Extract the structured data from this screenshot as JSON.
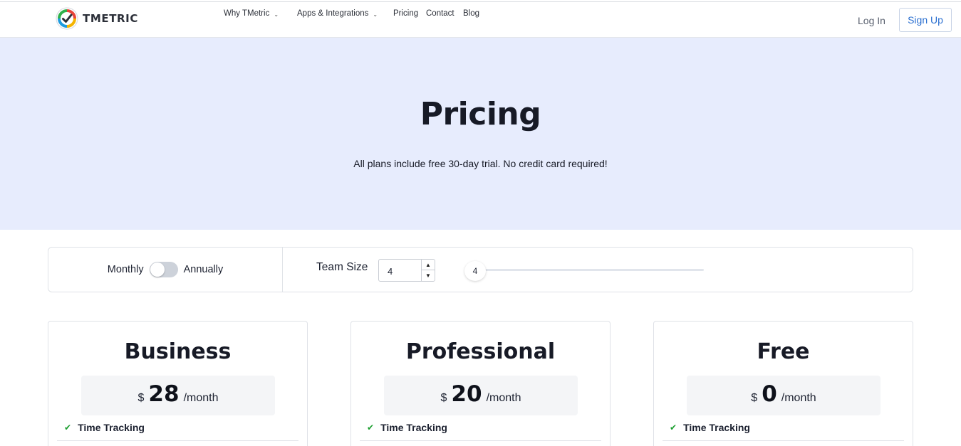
{
  "header": {
    "brand": "TMETRIC",
    "nav": [
      {
        "label": "Why TMetric",
        "dropdown": true
      },
      {
        "label": "Apps & Integrations",
        "dropdown": true
      },
      {
        "label": "Pricing",
        "dropdown": false
      },
      {
        "label": "Contact",
        "dropdown": false
      },
      {
        "label": "Blog",
        "dropdown": false
      }
    ],
    "login_label": "Log In",
    "signup_label": "Sign Up"
  },
  "hero": {
    "title": "Pricing",
    "subtitle": "All plans include free 30-day trial. No credit card required!"
  },
  "controls": {
    "billing_monthly": "Monthly",
    "billing_annually": "Annually",
    "billing_annual_selected": false,
    "team_size_label": "Team Size",
    "team_size_value": "4",
    "slider_value": "4"
  },
  "plans": [
    {
      "name": "Business",
      "currency": "$",
      "amount": "28",
      "period": "/month",
      "feature": "Time Tracking"
    },
    {
      "name": "Professional",
      "currency": "$",
      "amount": "20",
      "period": "/month",
      "feature": "Time Tracking"
    },
    {
      "name": "Free",
      "currency": "$",
      "amount": "0",
      "period": "/month",
      "feature": "Time Tracking"
    }
  ],
  "colors": {
    "hero_bg": "#e7ecfd",
    "signup_text": "#2a6fd0",
    "check": "#1a9e2e"
  },
  "icons": {
    "logo": "tmetric-logo-icon",
    "dropdown": "chevron-down-icon",
    "check": "check-icon",
    "spin_up": "arrow-up-icon",
    "spin_down": "arrow-down-icon"
  }
}
